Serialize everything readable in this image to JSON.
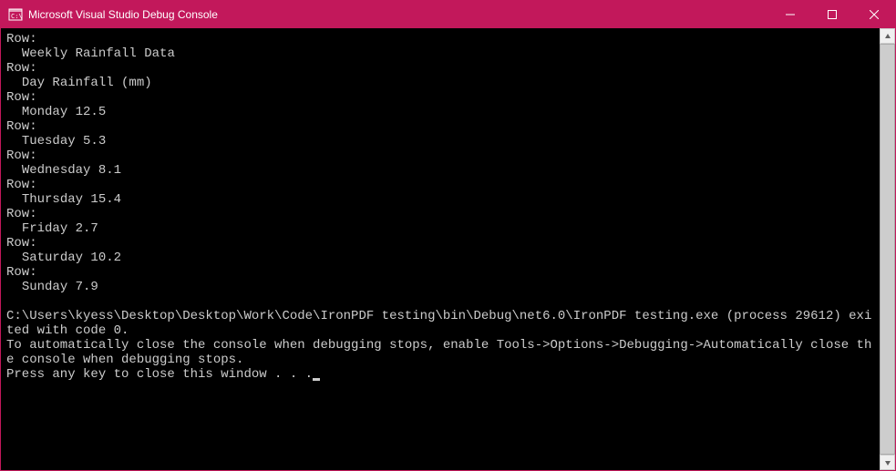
{
  "window": {
    "title": "Microsoft Visual Studio Debug Console"
  },
  "console": {
    "rows": [
      {
        "label": "Row:",
        "content": "  Weekly Rainfall Data"
      },
      {
        "label": "Row:",
        "content": "  Day Rainfall (mm)"
      },
      {
        "label": "Row:",
        "content": "  Monday 12.5"
      },
      {
        "label": "Row:",
        "content": "  Tuesday 5.3"
      },
      {
        "label": "Row:",
        "content": "  Wednesday 8.1"
      },
      {
        "label": "Row:",
        "content": "  Thursday 15.4"
      },
      {
        "label": "Row:",
        "content": "  Friday 2.7"
      },
      {
        "label": "Row:",
        "content": "  Saturday 10.2"
      },
      {
        "label": "Row:",
        "content": "  Sunday 7.9"
      }
    ],
    "exit_line": "C:\\Users\\kyess\\Desktop\\Desktop\\Work\\Code\\IronPDF testing\\bin\\Debug\\net6.0\\IronPDF testing.exe (process 29612) exited with code 0.",
    "auto_close_line": "To automatically close the console when debugging stops, enable Tools->Options->Debugging->Automatically close the console when debugging stops.",
    "press_key_line": "Press any key to close this window . . ."
  },
  "chart_data": {
    "type": "table",
    "title": "Weekly Rainfall Data",
    "columns": [
      "Day",
      "Rainfall (mm)"
    ],
    "rows": [
      [
        "Monday",
        12.5
      ],
      [
        "Tuesday",
        5.3
      ],
      [
        "Wednesday",
        8.1
      ],
      [
        "Thursday",
        15.4
      ],
      [
        "Friday",
        2.7
      ],
      [
        "Saturday",
        10.2
      ],
      [
        "Sunday",
        7.9
      ]
    ]
  }
}
